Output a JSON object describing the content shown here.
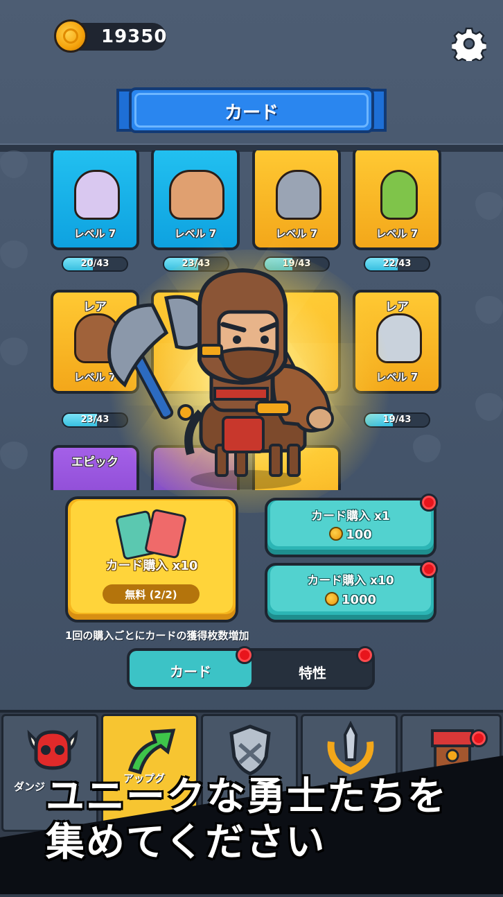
{
  "header": {
    "coins": "19350",
    "title": "カード"
  },
  "cards": [
    {
      "level": "レベル 7",
      "progress": "20/43",
      "fill": 0.465,
      "color": "blue",
      "rarity": ""
    },
    {
      "level": "レベル 7",
      "progress": "23/43",
      "fill": 0.535,
      "color": "blue",
      "rarity": ""
    },
    {
      "level": "レベル 7",
      "progress": "19/43",
      "fill": 0.44,
      "color": "gold",
      "rarity": ""
    },
    {
      "level": "レベル 7",
      "progress": "22/43",
      "fill": 0.51,
      "color": "gold",
      "rarity": ""
    },
    {
      "level": "レベル 7",
      "progress": "23/43",
      "fill": 0.535,
      "color": "gold",
      "rarity": "レア"
    },
    {
      "level": "レベル 7",
      "progress": "19/43",
      "fill": 0.44,
      "color": "gold",
      "rarity": "レア"
    },
    {
      "level": "",
      "progress": "",
      "fill": 0,
      "color": "purple",
      "rarity": "エピック"
    }
  ],
  "buy": {
    "big_label": "カード購入 x10",
    "big_free": "無料 (2/2)",
    "x1_label": "カード購入 x1",
    "x1_price": "100",
    "x10_label": "カード購入 x10",
    "x10_price": "1000",
    "note": "1回の購入ごとにカードの獲得枚数増加"
  },
  "tabs": {
    "cards": "カード",
    "traits": "特性"
  },
  "nav": {
    "dungeon": "ダンジ",
    "upgrade": "アップグ"
  },
  "promo": {
    "line1": "ユニークな勇士たちを",
    "line2": "集めてください"
  },
  "colors": {
    "accent_blue": "#2a86ef",
    "teal": "#2cb5b5",
    "gold": "#f5b51d",
    "badge_red": "#e8151c"
  }
}
